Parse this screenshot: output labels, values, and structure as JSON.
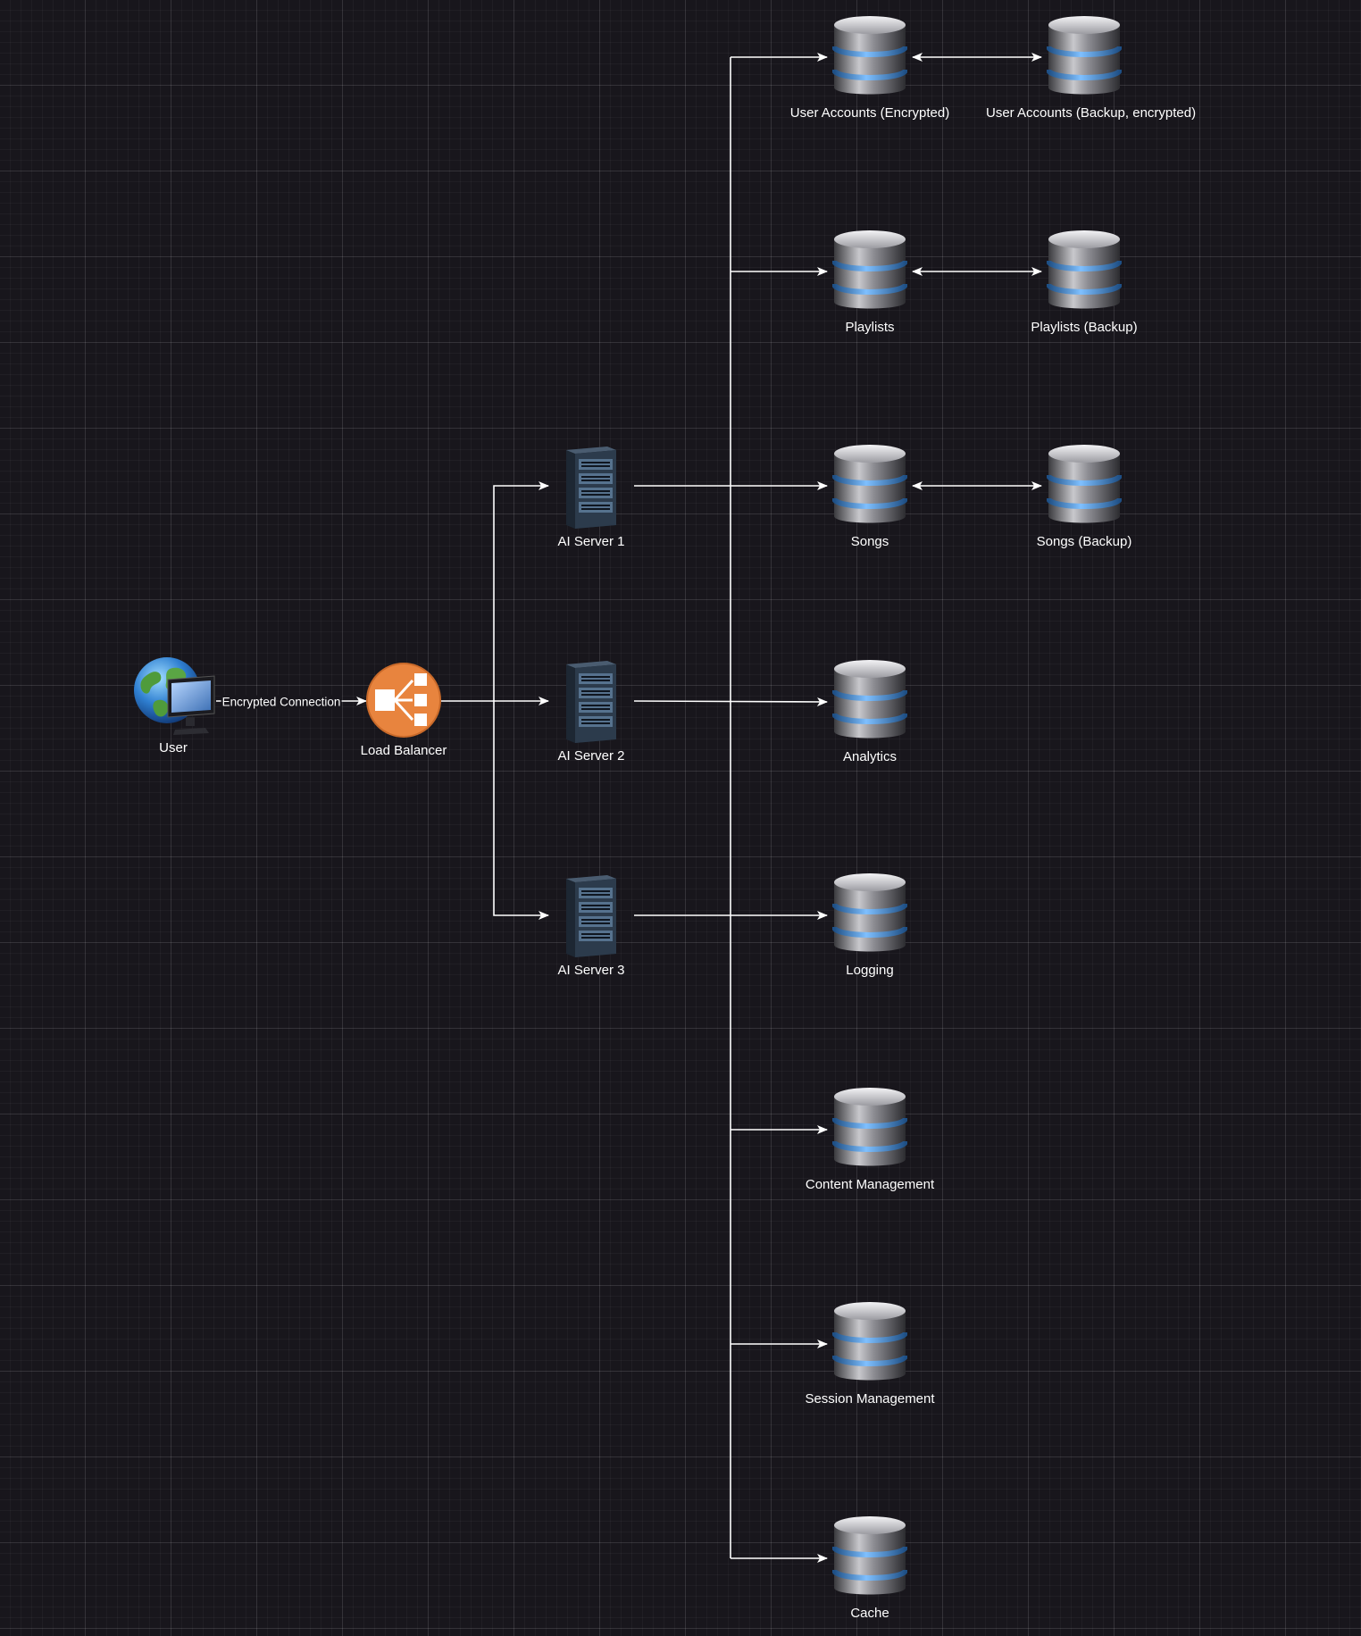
{
  "nodes": {
    "user": "User",
    "load_balancer": "Load Balancer",
    "ai_server_1": "AI Server 1",
    "ai_server_2": "AI Server 2",
    "ai_server_3": "AI Server 3",
    "db_user_accounts": "User Accounts (Encrypted)",
    "db_user_accounts_backup": "User Accounts (Backup, encrypted)",
    "db_playlists": "Playlists",
    "db_playlists_backup": "Playlists (Backup)",
    "db_songs": "Songs",
    "db_songs_backup": "Songs (Backup)",
    "db_analytics": "Analytics",
    "db_logging": "Logging",
    "db_content_management": "Content Management",
    "db_session_management": "Session Management",
    "db_cache": "Cache"
  },
  "edges": {
    "user_to_lb_label": "Encrypted Connection"
  },
  "colors": {
    "background": "#18161c",
    "line": "#ffffff",
    "text": "#ffffff",
    "load_balancer": "#e8843e",
    "db_band": "#4a90d9"
  }
}
